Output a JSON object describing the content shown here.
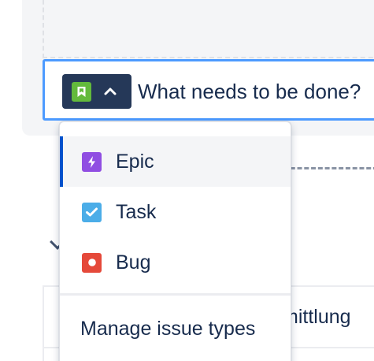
{
  "create_issue": {
    "placeholder": "What needs to be done?",
    "selected_type": "Story"
  },
  "type_menu": {
    "items": [
      {
        "label": "Epic",
        "icon": "epic-icon",
        "color": "#904ee2",
        "selected": true
      },
      {
        "label": "Task",
        "icon": "task-icon",
        "color": "#4bade8",
        "selected": false
      },
      {
        "label": "Bug",
        "icon": "bug-icon",
        "color": "#e5493a",
        "selected": false
      }
    ],
    "manage_label": "Manage issue types"
  },
  "background": {
    "partial_cell_text": "mittlung"
  },
  "colors": {
    "story": "#63ba3c",
    "focus_border": "#4c9aff",
    "picker_bg": "#253858",
    "selected_bar": "#0052cc"
  }
}
